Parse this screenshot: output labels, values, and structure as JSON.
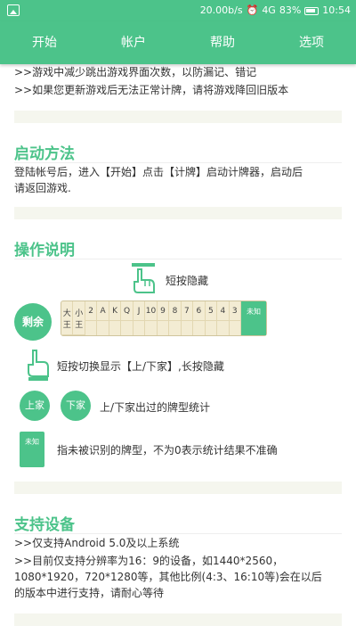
{
  "status_bar": {
    "speed": "20.00b/s",
    "signal": "4G",
    "battery": "83%",
    "time": "10:54"
  },
  "tabs": [
    {
      "label": "开始"
    },
    {
      "label": "帐户"
    },
    {
      "label": "帮助"
    },
    {
      "label": "选项"
    }
  ],
  "notes": {
    "cut_line": ">>游戏中减少跳出游戏界面次数，以防漏记、错记",
    "downgrade_line": ">>如果您更新游戏后无法正常计牌，请将游戏降回旧版本"
  },
  "startup": {
    "heading": "启动方法",
    "body_line1": "登陆帐号后，进入【开始】点击【计牌】启动计牌器，启动后",
    "body_line2": "请返回游戏."
  },
  "operation": {
    "heading": "操作说明",
    "tap_hide": "短按隐藏",
    "remain_label": "剩余",
    "cards": [
      "大王",
      "小王",
      "2",
      "A",
      "K",
      "Q",
      "J",
      "10",
      "9",
      "8",
      "7",
      "6",
      "5",
      "4",
      "3"
    ],
    "unknown_label": "未知",
    "toggle_text": "短按切换显示【上/下家】,长按隐藏",
    "up_label": "上家",
    "down_label": "下家",
    "played_stats": "上/下家出过的牌型统计",
    "unknown_box_label": "未知",
    "unknown_desc": "指未被识别的牌型，不为0表示统计结果不准确"
  },
  "devices": {
    "heading": "支持设备",
    "line1": ">>仅支持Android 5.0及以上系统",
    "line2": ">>目前仅支持分辨率为16：9的设备，如1440*2560，",
    "line3": "1080*1920，720*1280等，其他比例(4:3、16:10等)会在以后",
    "line4": "的版本中进行支持，请耐心等待"
  },
  "colors": {
    "accent": "#4cc38a",
    "divider": "#f5f6ee"
  },
  "icons": [
    "image-icon",
    "alarm-icon",
    "signal-icon",
    "battery-icon",
    "hand-tap-icon",
    "hand-point-icon"
  ]
}
